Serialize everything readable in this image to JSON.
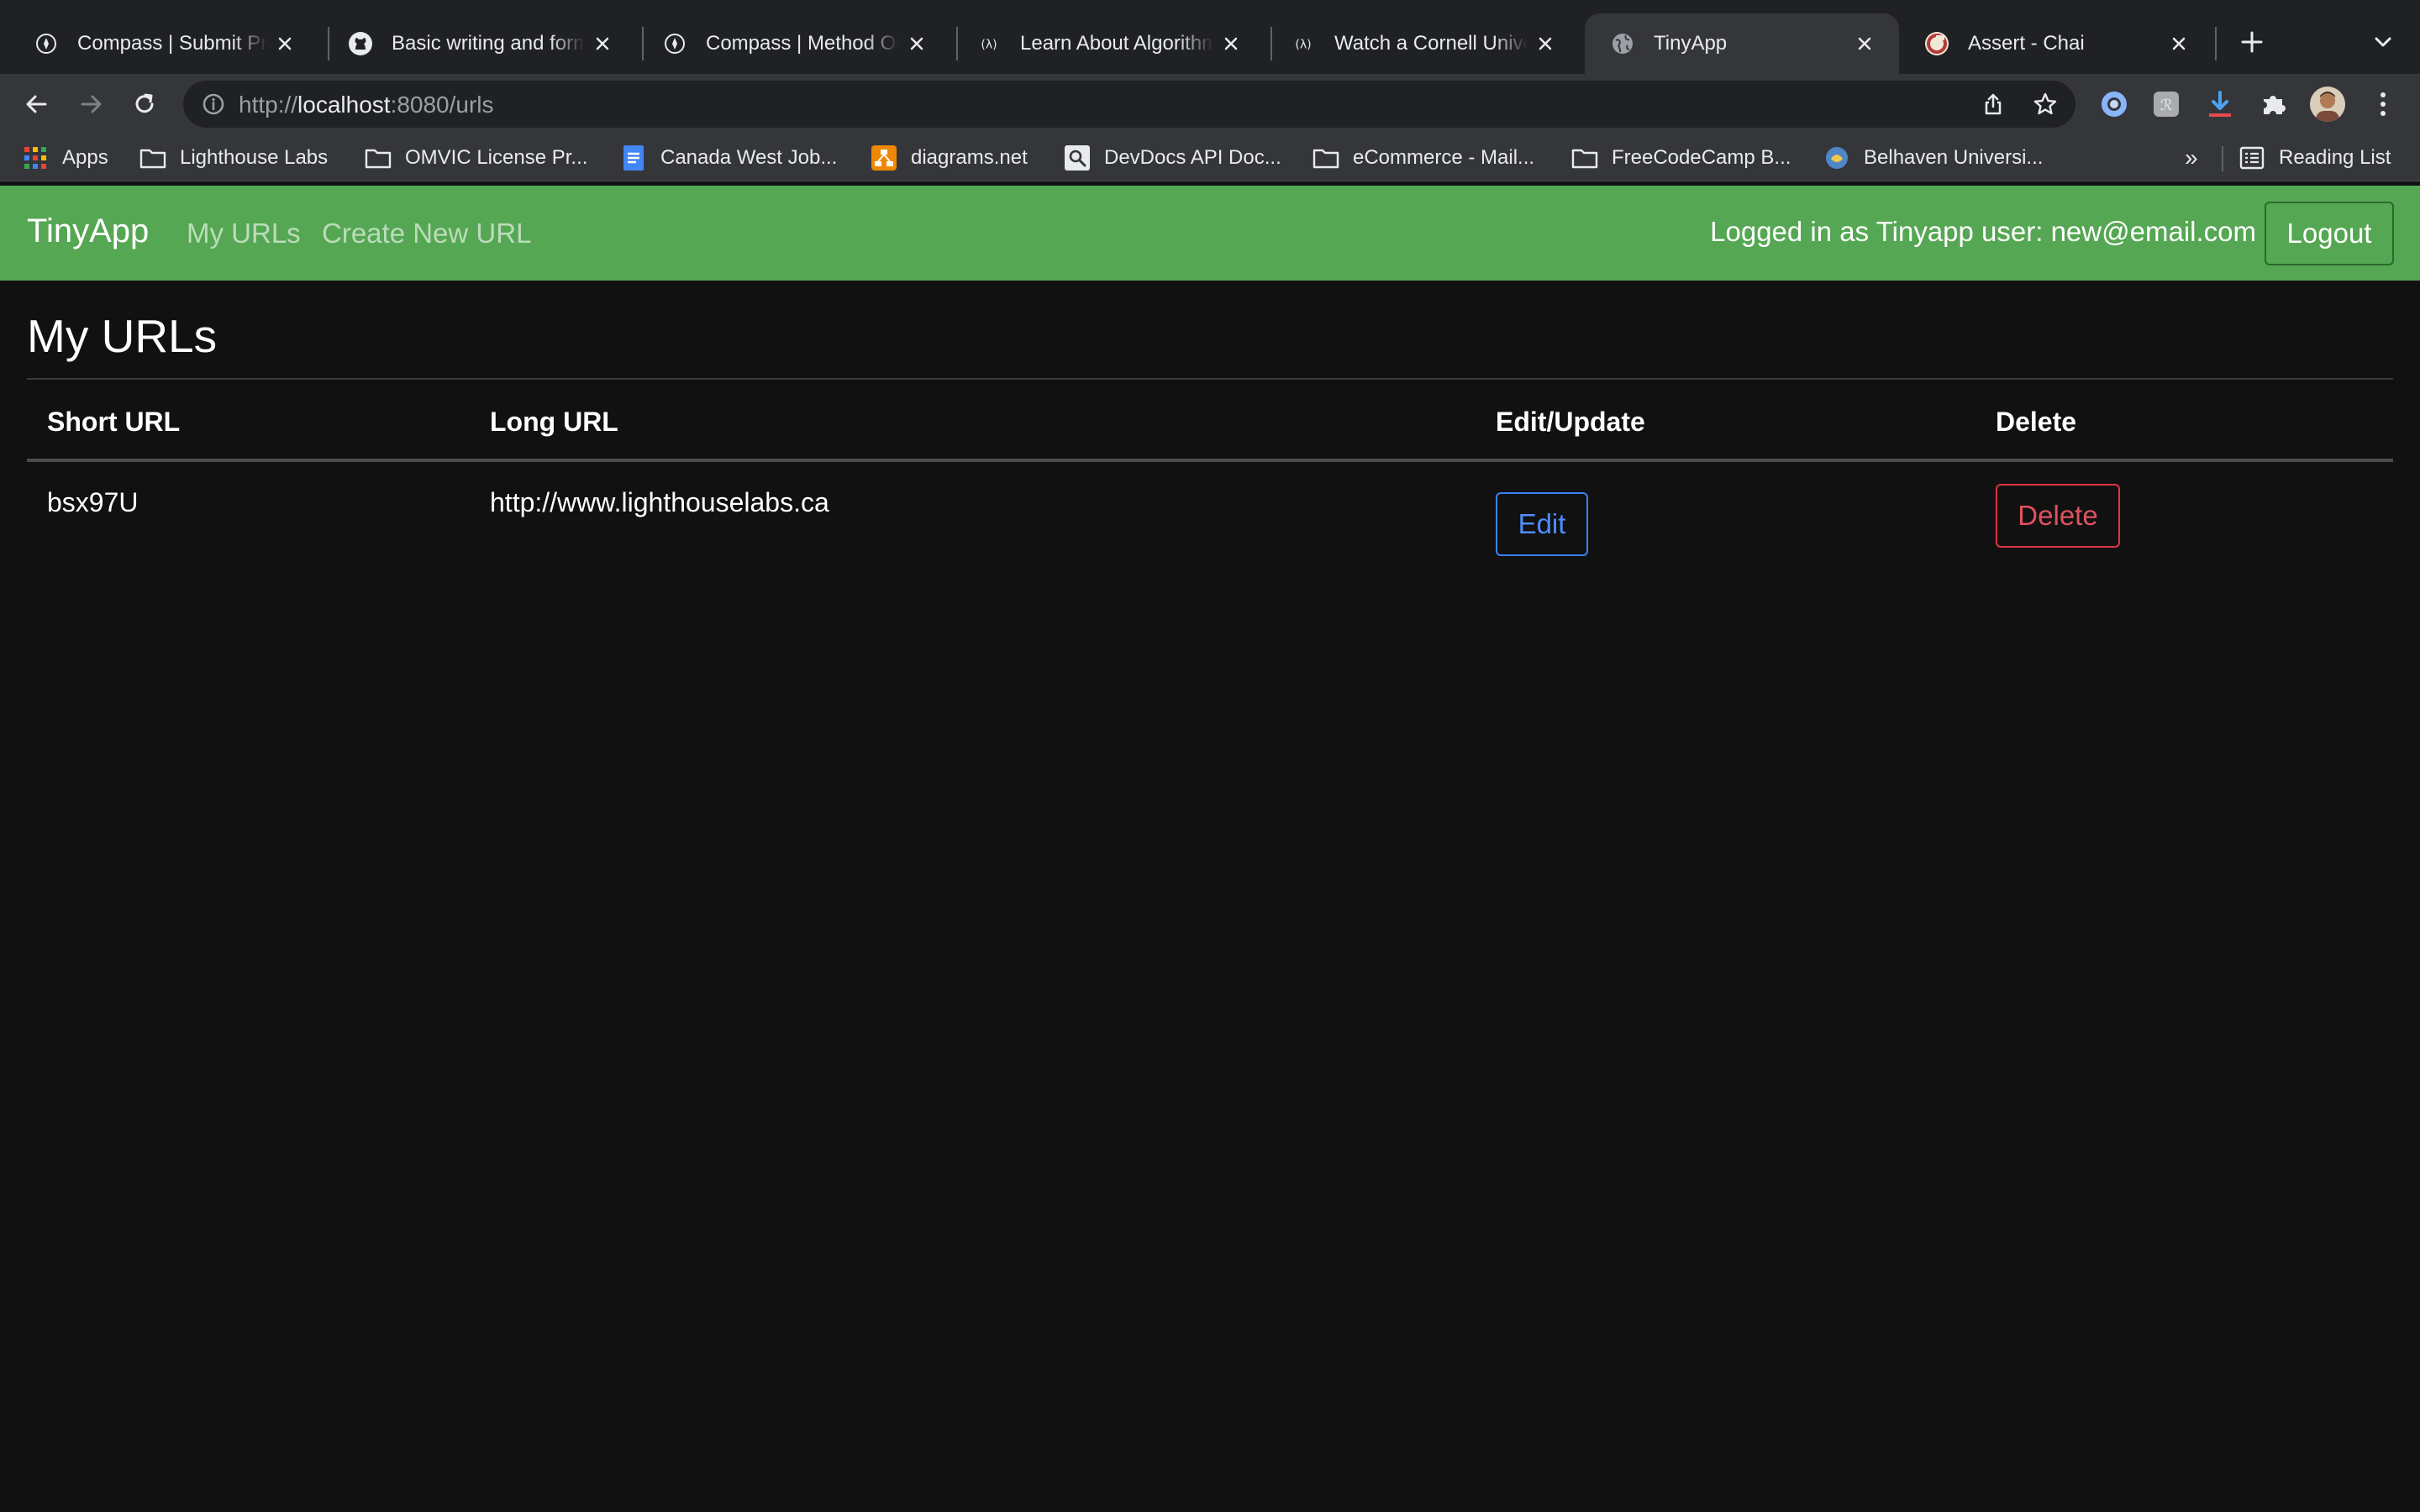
{
  "browser": {
    "tabs": [
      {
        "title": "Compass | Submit Pro",
        "icon": "compass-icon"
      },
      {
        "title": "Basic writing and form",
        "icon": "github-icon"
      },
      {
        "title": "Compass | Method Ov",
        "icon": "compass-icon"
      },
      {
        "title": "Learn About Algorithm",
        "icon": "freecodecamp-icon"
      },
      {
        "title": "Watch a Cornell Unive",
        "icon": "freecodecamp-icon"
      },
      {
        "title": "TinyApp",
        "icon": "globe-icon",
        "active": true
      },
      {
        "title": "Assert - Chai",
        "icon": "chai-icon"
      }
    ],
    "address": {
      "scheme": "http://",
      "host": "localhost",
      "rest": ":8080/urls"
    },
    "bookmarks": [
      {
        "label": "Apps",
        "icon": "apps-grid-icon"
      },
      {
        "label": "Lighthouse Labs",
        "icon": "folder-icon"
      },
      {
        "label": "OMVIC License Pr...",
        "icon": "folder-icon"
      },
      {
        "label": "Canada West Job...",
        "icon": "google-docs-icon"
      },
      {
        "label": "diagrams.net",
        "icon": "diagrams-icon"
      },
      {
        "label": "DevDocs API Doc...",
        "icon": "devdocs-icon"
      },
      {
        "label": "eCommerce - Mail...",
        "icon": "folder-icon"
      },
      {
        "label": "FreeCodeCamp B...",
        "icon": "folder-icon"
      },
      {
        "label": "Belhaven Universi...",
        "icon": "belhaven-icon"
      }
    ],
    "bookmarks_more": "»",
    "reading_list": "Reading List"
  },
  "navbar": {
    "brand": "TinyApp",
    "links": [
      "My URLs",
      "Create New URL"
    ],
    "logged_in_text": "Logged in as Tinyapp user: new@email.com",
    "logout_label": "Logout"
  },
  "main": {
    "heading": "My URLs",
    "columns": [
      "Short URL",
      "Long URL",
      "Edit/Update",
      "Delete"
    ],
    "rows": [
      {
        "short_url": "bsx97U",
        "long_url": "http://www.lighthouselabs.ca",
        "edit_label": "Edit",
        "delete_label": "Delete"
      }
    ]
  },
  "colors": {
    "navbar_bg": "#55a753",
    "page_bg": "#111111",
    "edit_accent": "#3b82f6",
    "delete_accent": "#dc3545"
  }
}
